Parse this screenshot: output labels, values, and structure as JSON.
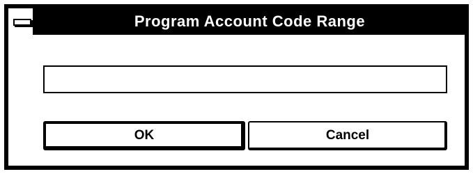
{
  "dialog": {
    "title": "Program Account Code Range",
    "input": {
      "value": "",
      "placeholder": ""
    },
    "buttons": {
      "ok_label": "OK",
      "cancel_label": "Cancel"
    }
  },
  "colors": {
    "titlebar": "#000000",
    "title_text": "#ffffff",
    "frame": "#000000",
    "background": "#ffffff"
  },
  "icons": {
    "system_menu": "system-menu-icon"
  }
}
